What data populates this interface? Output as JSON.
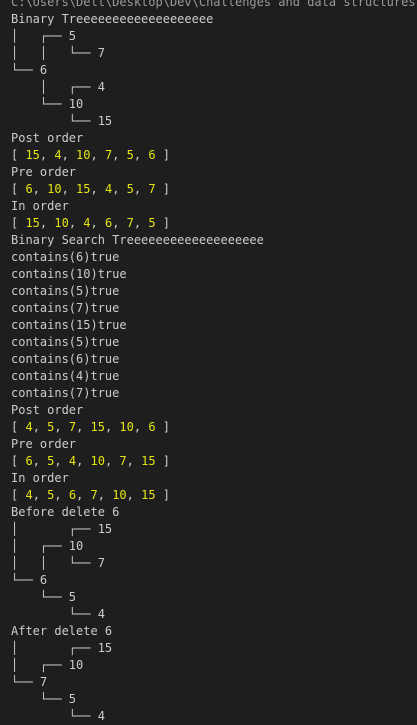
{
  "terminal": {
    "lines": [
      {
        "kind": "text",
        "text": "C:\\Users\\Dell\\Desktop\\Dev\\Challenges and data structures"
      },
      {
        "kind": "text",
        "text": "Binary Treeeeeeeeeeeeeeeeeee"
      },
      {
        "kind": "text",
        "text": "│   ┌── 5"
      },
      {
        "kind": "text",
        "text": "│   │   └── 7"
      },
      {
        "kind": "text",
        "text": "└── 6"
      },
      {
        "kind": "text",
        "text": "    │   ┌── 4"
      },
      {
        "kind": "text",
        "text": "    └── 10"
      },
      {
        "kind": "text",
        "text": "        └── 15"
      },
      {
        "kind": "text",
        "text": "Post order"
      },
      {
        "kind": "array",
        "values": [
          "15",
          "4",
          "10",
          "7",
          "5",
          "6"
        ]
      },
      {
        "kind": "text",
        "text": "Pre order"
      },
      {
        "kind": "array",
        "values": [
          "6",
          "10",
          "15",
          "4",
          "5",
          "7"
        ]
      },
      {
        "kind": "text",
        "text": "In order"
      },
      {
        "kind": "array",
        "values": [
          "15",
          "10",
          "4",
          "6",
          "7",
          "5"
        ]
      },
      {
        "kind": "text",
        "text": "Binary Search Treeeeeeeeeeeeeeeeeee"
      },
      {
        "kind": "text",
        "text": "contains(6)true"
      },
      {
        "kind": "text",
        "text": "contains(10)true"
      },
      {
        "kind": "text",
        "text": "contains(5)true"
      },
      {
        "kind": "text",
        "text": "contains(7)true"
      },
      {
        "kind": "text",
        "text": "contains(15)true"
      },
      {
        "kind": "text",
        "text": "contains(5)true"
      },
      {
        "kind": "text",
        "text": "contains(6)true"
      },
      {
        "kind": "text",
        "text": "contains(4)true"
      },
      {
        "kind": "text",
        "text": "contains(7)true"
      },
      {
        "kind": "text",
        "text": "Post order"
      },
      {
        "kind": "array",
        "values": [
          "4",
          "5",
          "7",
          "15",
          "10",
          "6"
        ]
      },
      {
        "kind": "text",
        "text": "Pre order"
      },
      {
        "kind": "array",
        "values": [
          "6",
          "5",
          "4",
          "10",
          "7",
          "15"
        ]
      },
      {
        "kind": "text",
        "text": "In order"
      },
      {
        "kind": "array",
        "values": [
          "4",
          "5",
          "6",
          "7",
          "10",
          "15"
        ]
      },
      {
        "kind": "text",
        "text": "Before delete 6"
      },
      {
        "kind": "text",
        "text": "│       ┌── 15"
      },
      {
        "kind": "text",
        "text": "│   ┌── 10"
      },
      {
        "kind": "text",
        "text": "│   │   └── 7"
      },
      {
        "kind": "text",
        "text": "└── 6"
      },
      {
        "kind": "text",
        "text": "    └── 5"
      },
      {
        "kind": "text",
        "text": "        └── 4"
      },
      {
        "kind": "text",
        "text": "After delete 6"
      },
      {
        "kind": "text",
        "text": "│       ┌── 15"
      },
      {
        "kind": "text",
        "text": "│   ┌── 10"
      },
      {
        "kind": "text",
        "text": "└── 7"
      },
      {
        "kind": "text",
        "text": "    └── 5"
      },
      {
        "kind": "text",
        "text": "        └── 4"
      }
    ]
  }
}
